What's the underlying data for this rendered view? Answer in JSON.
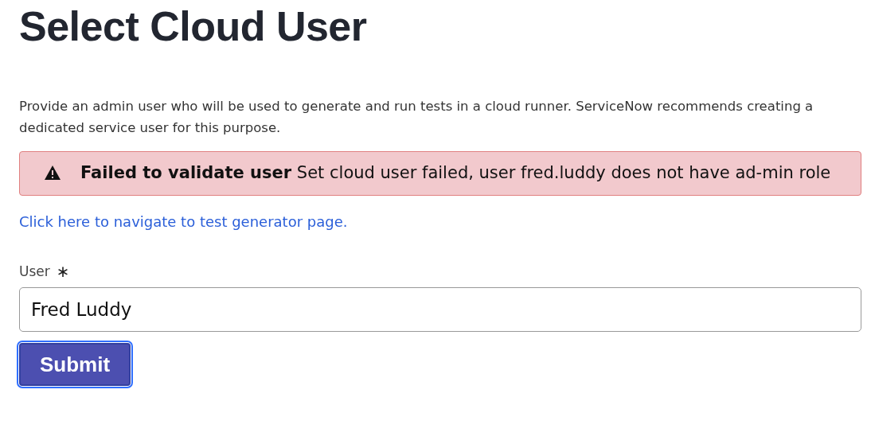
{
  "page": {
    "title": "Select Cloud User"
  },
  "description": "Provide an admin user who will be used to generate and run tests in a cloud runner. ServiceNow recommends creating a dedicated service user for this purpose.",
  "alert": {
    "kind": "error",
    "title": "Failed to validate user",
    "message": "Set cloud user failed, user fred.luddy does not have ad-min role"
  },
  "link": "Click here to navigate to test generator page.",
  "user_field": {
    "label": "User",
    "required_mark": "∗",
    "value": "Fred Luddy"
  },
  "submit_button": {
    "label": "Submit",
    "focused": true
  }
}
